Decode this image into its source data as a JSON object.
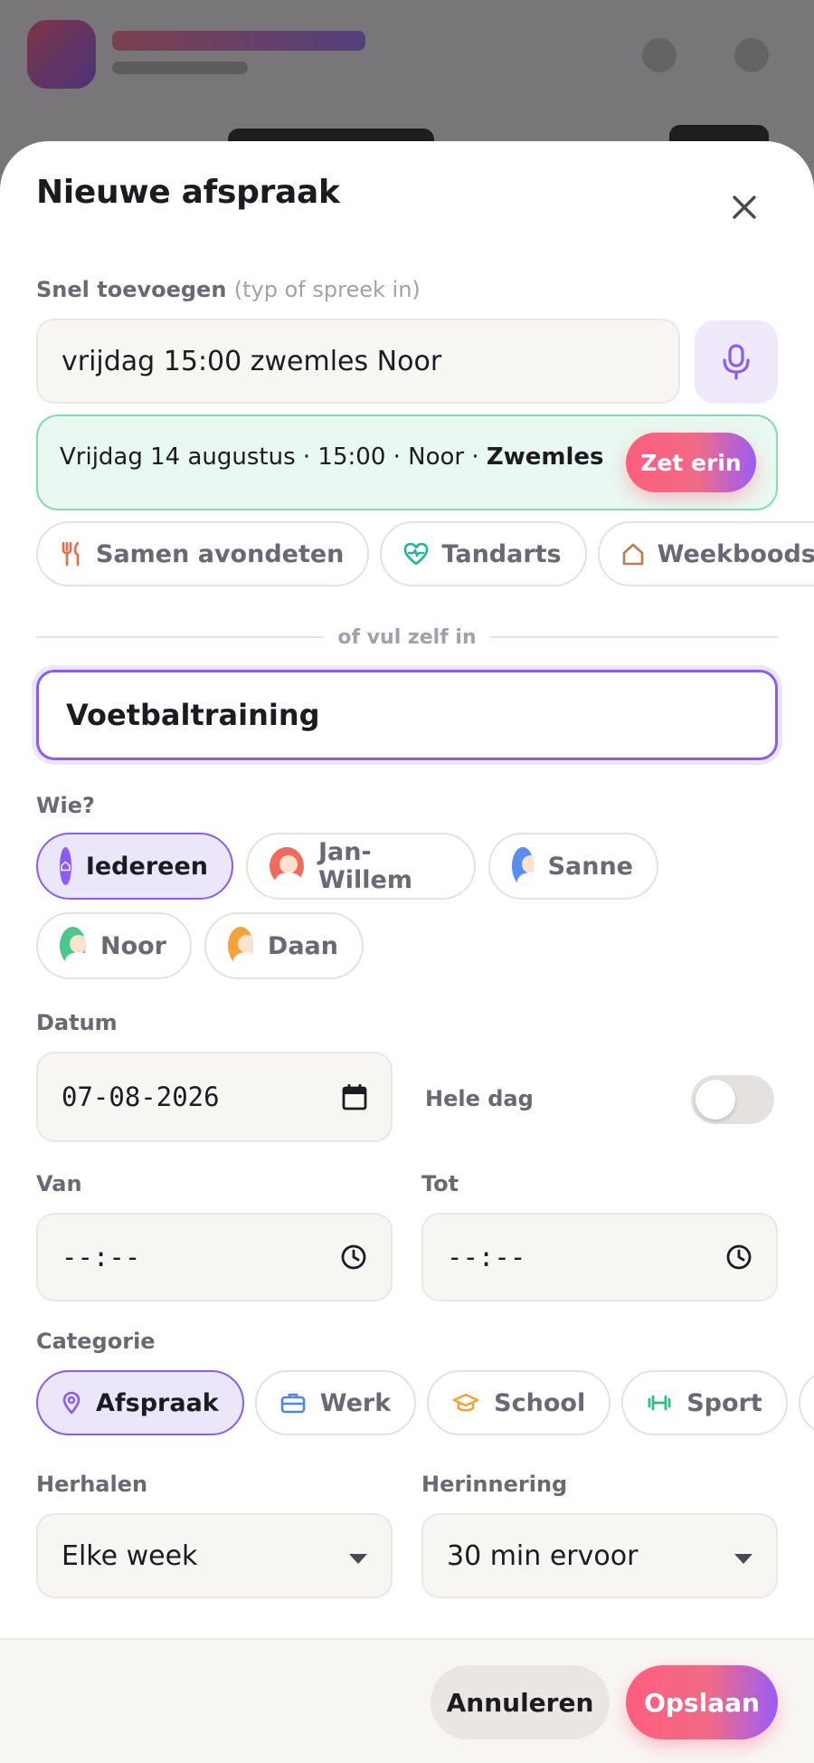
{
  "dialog": {
    "title": "Nieuwe afspraak",
    "close_label": "✕"
  },
  "quick_add": {
    "label": "Snel toevoegen",
    "hint": "(typ of spreek in)",
    "value": "vrijdag 15:00 zwemles Noor",
    "suggestion_prefix": "Vrijdag 14 augustus · 15:00 · Noor · ",
    "suggestion_bold": "Zwemles",
    "apply_button": "Zet erin"
  },
  "templates": [
    {
      "label": "Samen avondeten",
      "icon": "fork-knife-icon",
      "color": "#ef6b45"
    },
    {
      "label": "Tandarts",
      "icon": "heart-pulse-icon",
      "color": "#1fb5a4"
    },
    {
      "label": "Weekboodschappen",
      "icon": "home-icon",
      "color": "#c07a4d"
    }
  ],
  "divider_text": "of vul zelf in",
  "event_title": {
    "value": "Voetbaltraining"
  },
  "who": {
    "label": "Wie?",
    "people": [
      {
        "name": "Iedereen",
        "selected": true,
        "color": "#8a5cf6"
      },
      {
        "name": "Jan-Willem",
        "selected": false,
        "color": "#f06b5c"
      },
      {
        "name": "Sanne",
        "selected": false,
        "color": "#5b8def"
      },
      {
        "name": "Noor",
        "selected": false,
        "color": "#4fc58e"
      },
      {
        "name": "Daan",
        "selected": false,
        "color": "#f2a33a"
      }
    ]
  },
  "date": {
    "label": "Datum",
    "value": "07-08-2026",
    "all_day_label": "Hele dag",
    "all_day_on": false
  },
  "time": {
    "from_label": "Van",
    "from_value": "--:--",
    "to_label": "Tot",
    "to_value": "--:--"
  },
  "category": {
    "label": "Categorie",
    "options": [
      {
        "label": "Afspraak",
        "icon": "location-pin-icon",
        "color": "#8a5cf6",
        "selected": true
      },
      {
        "label": "Werk",
        "icon": "briefcase-icon",
        "color": "#4f86e8",
        "selected": false
      },
      {
        "label": "School",
        "icon": "graduation-cap-icon",
        "color": "#f2a33a",
        "selected": false
      },
      {
        "label": "Sport",
        "icon": "dumbbell-icon",
        "color": "#2fbf83",
        "selected": false
      }
    ]
  },
  "repeat": {
    "label": "Herhalen",
    "value": "Elke week"
  },
  "reminder": {
    "label": "Herinnering",
    "value": "30 min ervoor"
  },
  "footer": {
    "cancel_label": "Annuleren",
    "save_label": "Opslaan"
  }
}
